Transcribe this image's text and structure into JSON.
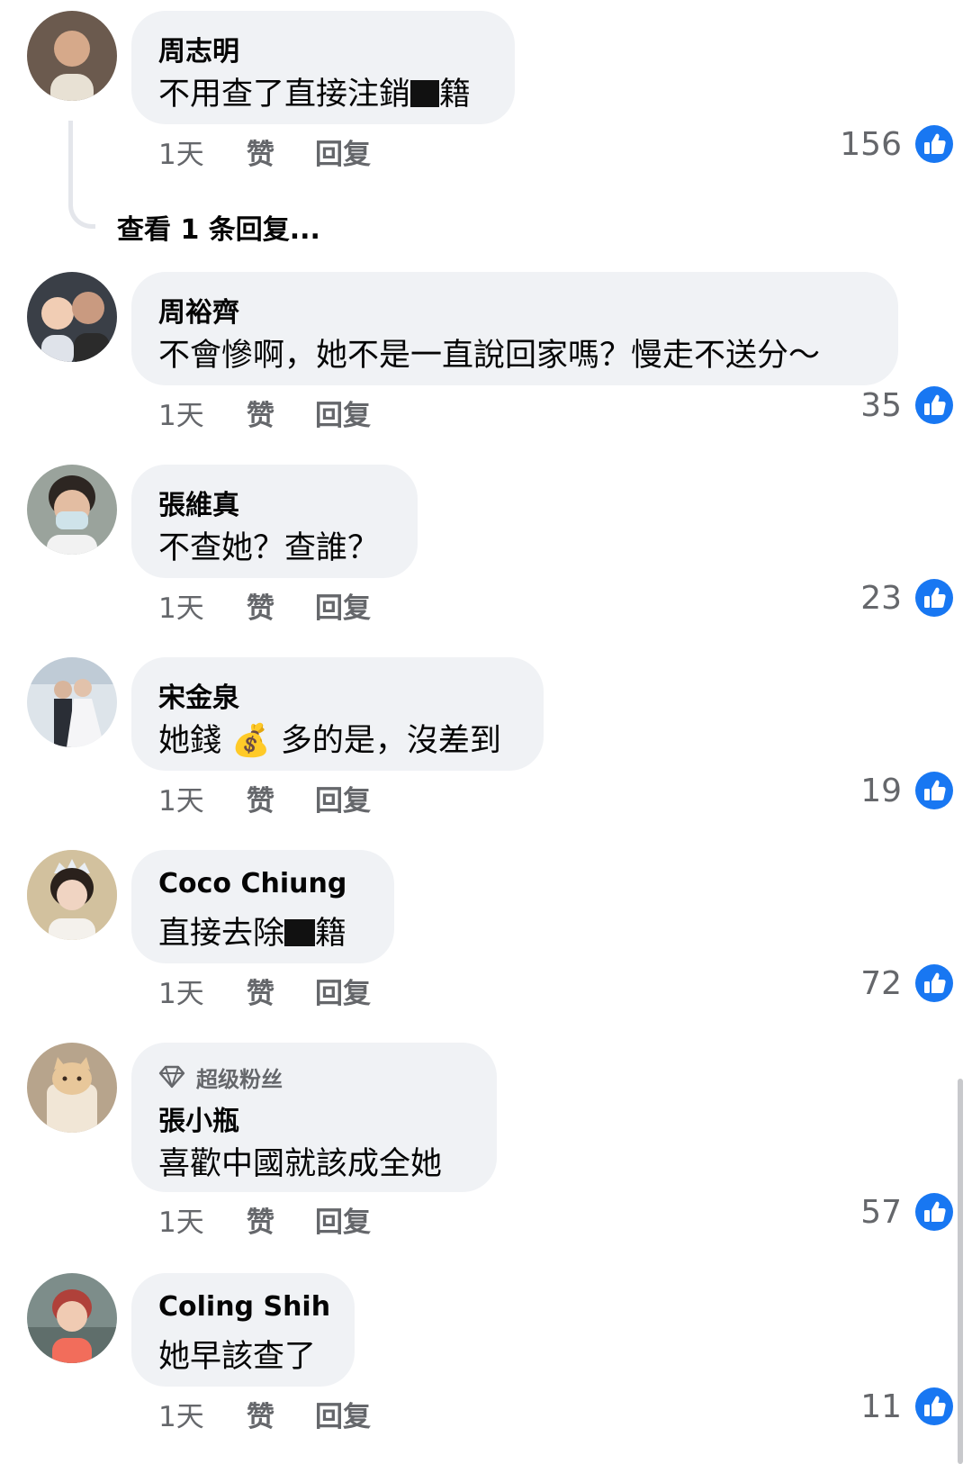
{
  "colors": {
    "bubble_bg": "#f0f2f5",
    "secondary_text": "#65676b",
    "like_blue": "#1877f2"
  },
  "comments": [
    {
      "author": "周志明",
      "text_a": "不用查了直接注銷",
      "text_b": "籍",
      "time": "1天",
      "like": "赞",
      "reply": "回复",
      "count": "156",
      "view_replies": "查看 1 条回复..."
    },
    {
      "author": "周裕齊",
      "text": "不會慘啊，她不是一直說回家嗎？慢走不送分～",
      "time": "1天",
      "like": "赞",
      "reply": "回复",
      "count": "35"
    },
    {
      "author": "張維真",
      "text": "不查她？查誰？",
      "time": "1天",
      "like": "赞",
      "reply": "回复",
      "count": "23"
    },
    {
      "author": "宋金泉",
      "text_a": "她錢",
      "emoji": "💰",
      "text_b": "多的是，沒差到",
      "time": "1天",
      "like": "赞",
      "reply": "回复",
      "count": "19"
    },
    {
      "author": "Coco Chiung",
      "text_a": "直接去除",
      "text_b": "籍",
      "time": "1天",
      "like": "赞",
      "reply": "回复",
      "count": "72"
    },
    {
      "badge": "超级粉丝",
      "author": "張小瓶",
      "text": "喜歡中國就該成全她",
      "time": "1天",
      "like": "赞",
      "reply": "回复",
      "count": "57"
    },
    {
      "author": "Coling Shih",
      "text": "她早該查了",
      "time": "1天",
      "like": "赞",
      "reply": "回复",
      "count": "11"
    }
  ]
}
